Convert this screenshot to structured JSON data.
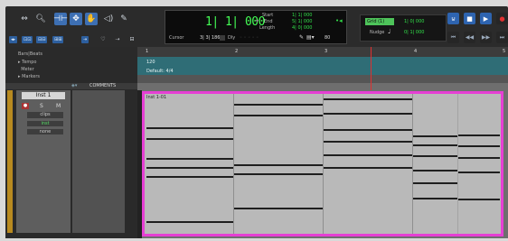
{
  "toolbar": {
    "cursor_label": "Cursor",
    "cursor_value": "3| 3| 186",
    "main_counter": "1| 1| 000",
    "start_label": "Start",
    "end_label": "End",
    "length_label": "Length",
    "start_value": "1| 1| 000",
    "end_value": "5| 1| 000",
    "length_value": "4| 0| 000",
    "dly_label": "Dly",
    "grid_value": "80",
    "grid_mode": "Grid",
    "grid_num": "(1)",
    "grid_time": "1| 0| 000",
    "nudge_label": "Nudge",
    "nudge_time": "0| 1| 000"
  },
  "rulers": {
    "bars_beats": "Bars|Beats",
    "tempo": "Tempo",
    "meter": "Meter",
    "markers": "Markers",
    "tempo_value": "120",
    "meter_value": "Default: 4/4",
    "bar_numbers": [
      "1",
      "2",
      "3",
      "4",
      "5"
    ]
  },
  "tracks_header": {
    "comments": "COMMENTS"
  },
  "track": {
    "name": "Inst 1",
    "view": "clips",
    "input": "inst",
    "auto": "none",
    "state": "S",
    "mode": "M"
  },
  "clip": {
    "name": "Inst 1-01"
  },
  "colors": {
    "clip_border": "#e63fd4",
    "counter_text": "#44ff55",
    "tool_selected": "#3d6fb3",
    "record": "#e03030"
  }
}
